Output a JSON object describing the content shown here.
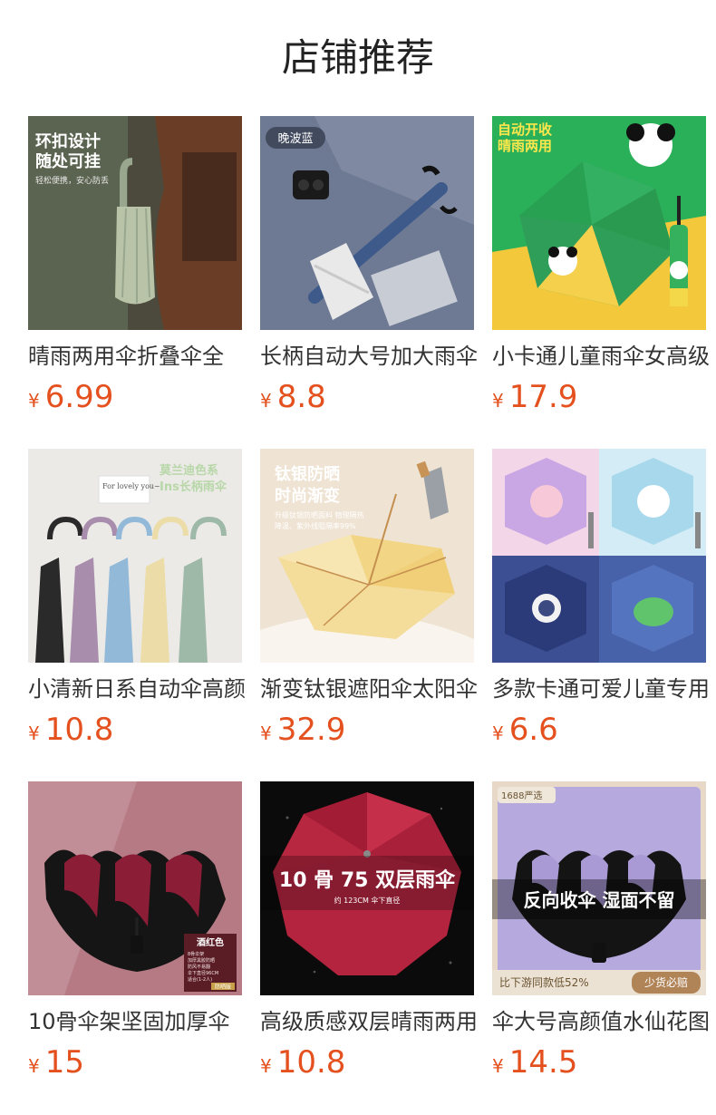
{
  "page": {
    "title": "店铺推荐"
  },
  "currency_symbol": "¥",
  "products": [
    {
      "title": "晴雨两用伞折叠伞全",
      "price": "6.99",
      "image_text": {
        "headline1": "环扣设计",
        "headline2": "随处可挂",
        "sub": "轻松便携，安心防丢"
      }
    },
    {
      "title": "长柄自动大号加大雨伞",
      "price": "8.8",
      "image_text": {
        "badge": "晚波蓝"
      }
    },
    {
      "title": "小卡通儿童雨伞女高级",
      "price": "17.9",
      "image_text": {
        "headline1": "自动开收",
        "headline2": "晴雨两用"
      }
    },
    {
      "title": "小清新日系自动伞高颜",
      "price": "10.8",
      "image_text": {
        "note": "For lovely you~",
        "headline1": "莫兰迪色系",
        "headline2": "Ins长柄雨伞"
      }
    },
    {
      "title": "渐变钛银遮阳伞太阳伞",
      "price": "32.9",
      "image_text": {
        "headline1": "钛银防晒",
        "headline2": "时尚渐变",
        "sub1": "升级钛银防晒面料 物理隔热",
        "sub2": "降温、紫外线阻隔率99%"
      }
    },
    {
      "title": "多款卡通可爱儿童专用",
      "price": "6.6",
      "image_text": {}
    },
    {
      "title": "10骨伞架坚固加厚伞",
      "price": "15",
      "image_text": {
        "label": "酒红色",
        "spec1": "8骨伞架",
        "spec2": "加厚黑胶防晒",
        "spec3": "防风不易翻",
        "spec4": "伞下直径96CM",
        "spec5": "适合(1-2人)",
        "tag": "防晒版"
      }
    },
    {
      "title": "高级质感双层晴雨两用",
      "price": "10.8",
      "image_text": {
        "headline1": "10 骨 75 双层雨伞",
        "sub": "约 123CM 伞下直径"
      }
    },
    {
      "title": "伞大号高颜值水仙花图",
      "price": "14.5",
      "image_text": {
        "brand": "1688严选",
        "headline1": "反向收伞 湿面不留",
        "footer1": "比下游同款低52%",
        "footer2": "少货必赔"
      }
    }
  ]
}
